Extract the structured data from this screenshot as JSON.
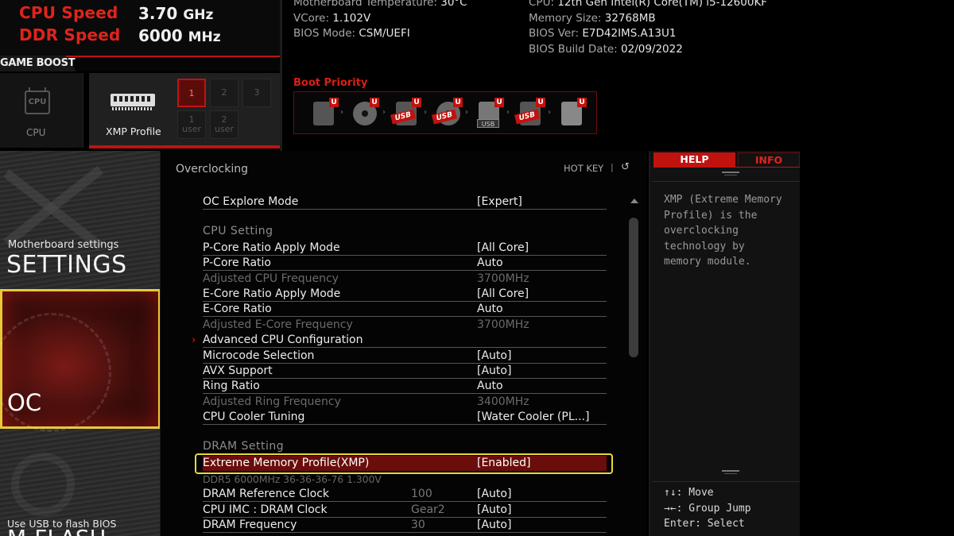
{
  "header": {
    "cpu_speed_label": "CPU Speed",
    "cpu_speed_value": "3.70",
    "cpu_speed_unit": "GHz",
    "ddr_speed_label": "DDR Speed",
    "ddr_speed_value": "6000",
    "ddr_speed_unit": "MHz"
  },
  "system_info": {
    "left": [
      {
        "label": "Motherboard Temperature: ",
        "value": "30°C"
      },
      {
        "label": "VCore: ",
        "value": "1.102V"
      },
      {
        "label": "BIOS Mode: ",
        "value": "CSM/UEFI"
      }
    ],
    "right": [
      {
        "label": "CPU: ",
        "value": "12th Gen Intel(R) Core(TM) i5-12600KF"
      },
      {
        "label": "Memory Size: ",
        "value": "32768MB"
      },
      {
        "label": "BIOS Ver: ",
        "value": "E7D42IMS.A13U1"
      },
      {
        "label": "BIOS Build Date: ",
        "value": "02/09/2022"
      }
    ]
  },
  "game_boost": {
    "label": "GAME BOOST",
    "cpu_tile": {
      "chip_text": "CPU",
      "label": "CPU"
    },
    "xmp_tile": {
      "label": "XMP Profile"
    },
    "xmp_buttons": [
      "1",
      "2",
      "3"
    ],
    "xmp_user_buttons": [
      {
        "num": "1",
        "label": "user"
      },
      {
        "num": "2",
        "label": "user"
      }
    ]
  },
  "boot_priority": {
    "title": "Boot Priority",
    "badge": "U",
    "usb_label": "USB"
  },
  "nav": {
    "settings_sub": "Motherboard settings",
    "settings_title": "SETTINGS",
    "oc_title": "OC",
    "mflash_sub": "Use USB to flash BIOS",
    "mflash_title": "M-FLASH"
  },
  "main": {
    "title": "Overclocking",
    "hotkey": "HOT KEY",
    "hotkey_sep": "|",
    "back_icon": "↺",
    "rows": [
      {
        "label": "OC Explore Mode",
        "value": "[Expert]"
      },
      {
        "label": "CPU  Setting"
      },
      {
        "label": "P-Core Ratio Apply Mode",
        "value": "[All Core]"
      },
      {
        "label": "P-Core Ratio",
        "value": "Auto"
      },
      {
        "label": "Adjusted CPU Frequency",
        "value": "3700MHz"
      },
      {
        "label": "E-Core Ratio Apply Mode",
        "value": "[All Core]"
      },
      {
        "label": "E-Core Ratio",
        "value": "Auto"
      },
      {
        "label": "Adjusted E-Core Frequency",
        "value": "3700MHz"
      },
      {
        "label": "Advanced CPU Configuration"
      },
      {
        "label": "Microcode Selection",
        "value": "[Auto]"
      },
      {
        "label": "AVX Support",
        "value": "[Auto]"
      },
      {
        "label": "Ring Ratio",
        "value": "Auto"
      },
      {
        "label": "Adjusted Ring Frequency",
        "value": "3400MHz"
      },
      {
        "label": "CPU Cooler Tuning",
        "value": "[Water Cooler (PL...]"
      },
      {
        "label": "DRAM  Setting"
      },
      {
        "label": "Extreme Memory Profile(XMP)",
        "value": "[Enabled]"
      },
      {
        "label": "DDR5 6000MHz 36-36-36-76 1.300V"
      },
      {
        "label": "DRAM Reference Clock",
        "mid": "100",
        "value": "[Auto]"
      },
      {
        "label": "CPU IMC : DRAM Clock",
        "mid": "Gear2",
        "value": "[Auto]"
      },
      {
        "label": "DRAM Frequency",
        "mid": "30",
        "value": "[Auto]"
      }
    ]
  },
  "help": {
    "help_tab": "HELP",
    "info_tab": "INFO",
    "text": "XMP (Extreme Memory\nProfile) is the\noverclocking\ntechnology by\nmemory module.",
    "keys": "↑↓: Move\n→←: Group Jump\nEnter: Select"
  },
  "colors": {
    "accent_red": "#c0130f",
    "highlight_yellow": "#e8d83a",
    "selected_row": "#6a0d0b"
  }
}
